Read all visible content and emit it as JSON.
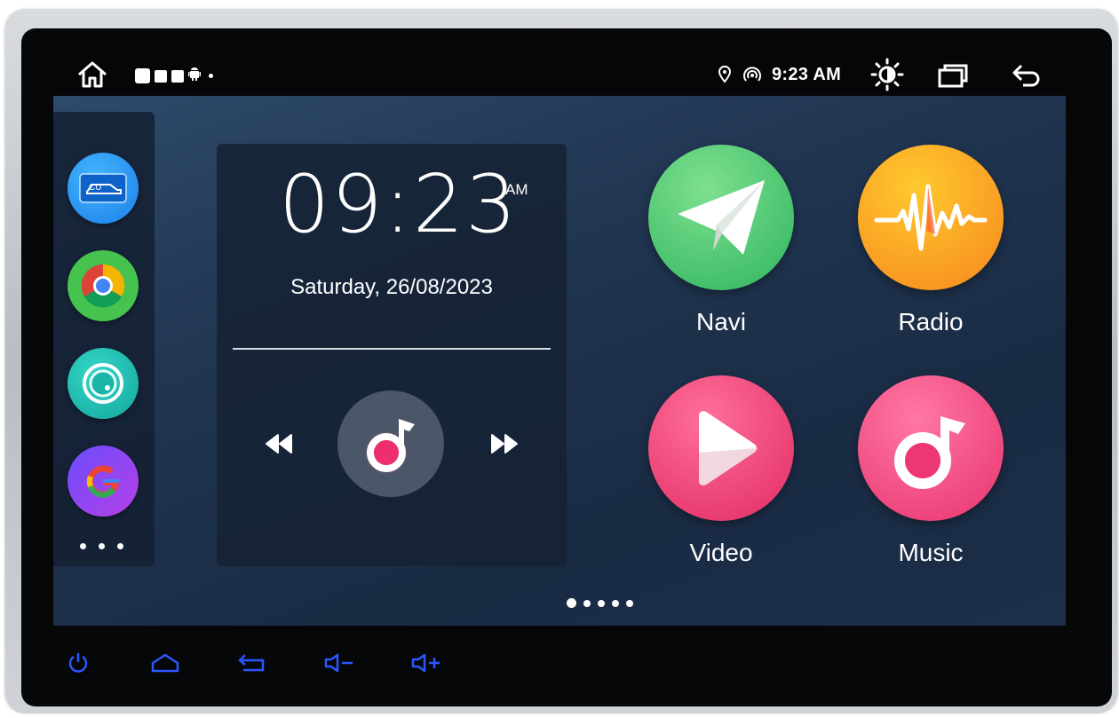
{
  "status_bar": {
    "time": "9:23 AM",
    "icons": [
      "home-icon",
      "notification-icon",
      "image-icon",
      "a-icon",
      "android-icon",
      "location-icon",
      "hotspot-icon",
      "brightness-icon",
      "recent-apps-icon",
      "back-icon"
    ]
  },
  "side_dock": {
    "apps": [
      "car-app-icon",
      "chrome-icon",
      "settings-icon",
      "google-icon"
    ]
  },
  "clock_widget": {
    "time": "09:23",
    "ampm": "AM",
    "date": "Saturday, 26/08/2023"
  },
  "apps": [
    {
      "label": "Navi",
      "color": "#3fc46d"
    },
    {
      "label": "Radio",
      "color": "#f9a019"
    },
    {
      "label": "Video",
      "color": "#e8306a"
    },
    {
      "label": "Music",
      "color": "#ef3f79"
    }
  ],
  "page_indicator": {
    "count": 5,
    "active": 1
  },
  "hardware_buttons": [
    "power-icon",
    "home-icon",
    "back-icon",
    "volume-down-icon",
    "volume-up-icon"
  ],
  "colors": {
    "accent_blue": "#2b57ff",
    "screen_bg": "#213651"
  }
}
